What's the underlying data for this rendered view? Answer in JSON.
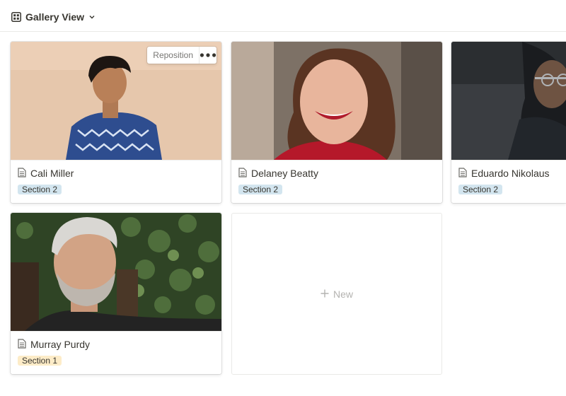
{
  "header": {
    "view_label": "Gallery View"
  },
  "cards": [
    {
      "title": "Cali Miller",
      "tag": "Section 2",
      "tag_color": "#d3e5ef",
      "actions": {
        "reposition_label": "Reposition"
      }
    },
    {
      "title": "Delaney Beatty",
      "tag": "Section 2",
      "tag_color": "#d3e5ef"
    },
    {
      "title": "Eduardo Nikolaus",
      "tag": "Section 2",
      "tag_color": "#d3e5ef"
    },
    {
      "title": "Murray Purdy",
      "tag": "Section 1",
      "tag_color": "#fdecc8"
    }
  ],
  "new_card": {
    "label": "New"
  },
  "icons": {
    "view": "gallery-grid-icon",
    "dropdown": "chevron-down-icon",
    "page": "page-document-icon",
    "more": "more-dots-icon",
    "add": "plus-icon"
  }
}
